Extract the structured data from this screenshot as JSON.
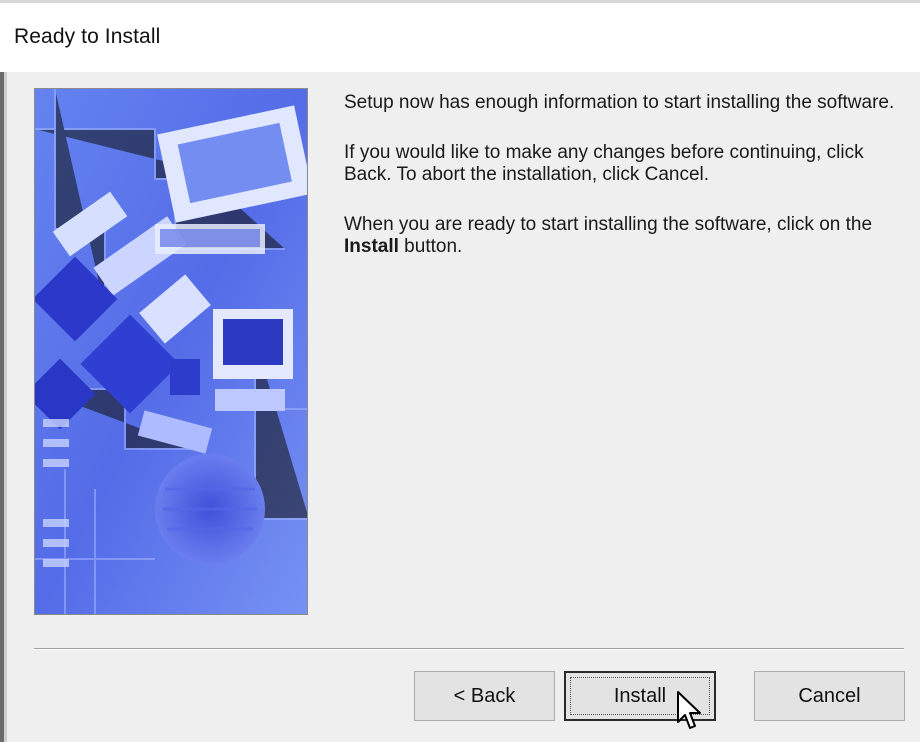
{
  "window": {
    "title": "Ready to Install"
  },
  "content": {
    "paragraph1": "Setup now has enough information to start installing the software.",
    "paragraph2": "If you would like to make any changes before continuing, click Back.  To abort the installation, click Cancel.",
    "paragraph3_before": "When you are ready to start installing the software, click on the ",
    "paragraph3_bold": "Install",
    "paragraph3_after": " button."
  },
  "buttons": {
    "back_label": "< Back",
    "install_label": "Install",
    "cancel_label": "Cancel"
  },
  "colors": {
    "dialog_bg": "#efefef",
    "art_primary": "#3d5ee0",
    "art_secondary": "#7f9bff"
  },
  "icons": {
    "side_image": "computer-hardware-illustration",
    "cursor": "arrow-cursor-icon"
  }
}
